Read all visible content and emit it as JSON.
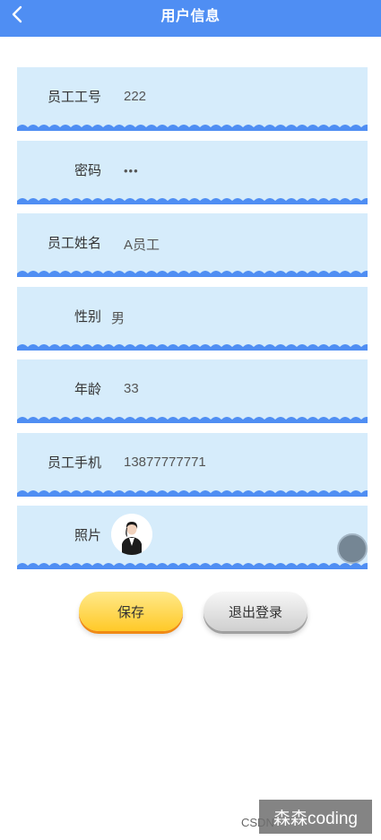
{
  "header": {
    "title": "用户信息"
  },
  "fields": [
    {
      "label": "员工工号",
      "value": "222"
    },
    {
      "label": "密码",
      "value": "•••"
    },
    {
      "label": "员工姓名",
      "value": "A员工"
    },
    {
      "label": "性别",
      "value": "男"
    },
    {
      "label": "年龄",
      "value": "33"
    },
    {
      "label": "员工手机",
      "value": "13877777771"
    },
    {
      "label": "照片",
      "value": ""
    }
  ],
  "actions": {
    "save_label": "保存",
    "logout_label": "退出登录"
  },
  "watermark": {
    "csdn": "CSDN",
    "author": "森森coding"
  },
  "colors": {
    "header": "#4f8ef3",
    "field_bg": "#d6ecfb",
    "wave": "#4f8ef3"
  }
}
